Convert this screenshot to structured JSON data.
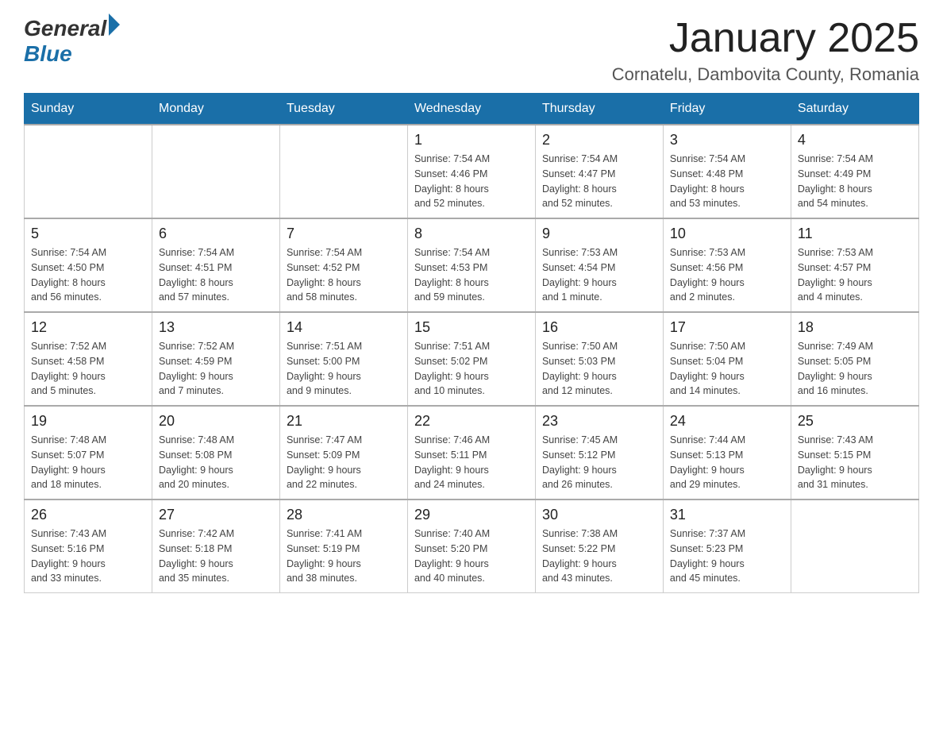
{
  "header": {
    "logo_general": "General",
    "logo_blue": "Blue",
    "month_title": "January 2025",
    "location": "Cornatelu, Dambovita County, Romania"
  },
  "days_of_week": [
    "Sunday",
    "Monday",
    "Tuesday",
    "Wednesday",
    "Thursday",
    "Friday",
    "Saturday"
  ],
  "weeks": [
    [
      {
        "day": "",
        "info": ""
      },
      {
        "day": "",
        "info": ""
      },
      {
        "day": "",
        "info": ""
      },
      {
        "day": "1",
        "info": "Sunrise: 7:54 AM\nSunset: 4:46 PM\nDaylight: 8 hours\nand 52 minutes."
      },
      {
        "day": "2",
        "info": "Sunrise: 7:54 AM\nSunset: 4:47 PM\nDaylight: 8 hours\nand 52 minutes."
      },
      {
        "day": "3",
        "info": "Sunrise: 7:54 AM\nSunset: 4:48 PM\nDaylight: 8 hours\nand 53 minutes."
      },
      {
        "day": "4",
        "info": "Sunrise: 7:54 AM\nSunset: 4:49 PM\nDaylight: 8 hours\nand 54 minutes."
      }
    ],
    [
      {
        "day": "5",
        "info": "Sunrise: 7:54 AM\nSunset: 4:50 PM\nDaylight: 8 hours\nand 56 minutes."
      },
      {
        "day": "6",
        "info": "Sunrise: 7:54 AM\nSunset: 4:51 PM\nDaylight: 8 hours\nand 57 minutes."
      },
      {
        "day": "7",
        "info": "Sunrise: 7:54 AM\nSunset: 4:52 PM\nDaylight: 8 hours\nand 58 minutes."
      },
      {
        "day": "8",
        "info": "Sunrise: 7:54 AM\nSunset: 4:53 PM\nDaylight: 8 hours\nand 59 minutes."
      },
      {
        "day": "9",
        "info": "Sunrise: 7:53 AM\nSunset: 4:54 PM\nDaylight: 9 hours\nand 1 minute."
      },
      {
        "day": "10",
        "info": "Sunrise: 7:53 AM\nSunset: 4:56 PM\nDaylight: 9 hours\nand 2 minutes."
      },
      {
        "day": "11",
        "info": "Sunrise: 7:53 AM\nSunset: 4:57 PM\nDaylight: 9 hours\nand 4 minutes."
      }
    ],
    [
      {
        "day": "12",
        "info": "Sunrise: 7:52 AM\nSunset: 4:58 PM\nDaylight: 9 hours\nand 5 minutes."
      },
      {
        "day": "13",
        "info": "Sunrise: 7:52 AM\nSunset: 4:59 PM\nDaylight: 9 hours\nand 7 minutes."
      },
      {
        "day": "14",
        "info": "Sunrise: 7:51 AM\nSunset: 5:00 PM\nDaylight: 9 hours\nand 9 minutes."
      },
      {
        "day": "15",
        "info": "Sunrise: 7:51 AM\nSunset: 5:02 PM\nDaylight: 9 hours\nand 10 minutes."
      },
      {
        "day": "16",
        "info": "Sunrise: 7:50 AM\nSunset: 5:03 PM\nDaylight: 9 hours\nand 12 minutes."
      },
      {
        "day": "17",
        "info": "Sunrise: 7:50 AM\nSunset: 5:04 PM\nDaylight: 9 hours\nand 14 minutes."
      },
      {
        "day": "18",
        "info": "Sunrise: 7:49 AM\nSunset: 5:05 PM\nDaylight: 9 hours\nand 16 minutes."
      }
    ],
    [
      {
        "day": "19",
        "info": "Sunrise: 7:48 AM\nSunset: 5:07 PM\nDaylight: 9 hours\nand 18 minutes."
      },
      {
        "day": "20",
        "info": "Sunrise: 7:48 AM\nSunset: 5:08 PM\nDaylight: 9 hours\nand 20 minutes."
      },
      {
        "day": "21",
        "info": "Sunrise: 7:47 AM\nSunset: 5:09 PM\nDaylight: 9 hours\nand 22 minutes."
      },
      {
        "day": "22",
        "info": "Sunrise: 7:46 AM\nSunset: 5:11 PM\nDaylight: 9 hours\nand 24 minutes."
      },
      {
        "day": "23",
        "info": "Sunrise: 7:45 AM\nSunset: 5:12 PM\nDaylight: 9 hours\nand 26 minutes."
      },
      {
        "day": "24",
        "info": "Sunrise: 7:44 AM\nSunset: 5:13 PM\nDaylight: 9 hours\nand 29 minutes."
      },
      {
        "day": "25",
        "info": "Sunrise: 7:43 AM\nSunset: 5:15 PM\nDaylight: 9 hours\nand 31 minutes."
      }
    ],
    [
      {
        "day": "26",
        "info": "Sunrise: 7:43 AM\nSunset: 5:16 PM\nDaylight: 9 hours\nand 33 minutes."
      },
      {
        "day": "27",
        "info": "Sunrise: 7:42 AM\nSunset: 5:18 PM\nDaylight: 9 hours\nand 35 minutes."
      },
      {
        "day": "28",
        "info": "Sunrise: 7:41 AM\nSunset: 5:19 PM\nDaylight: 9 hours\nand 38 minutes."
      },
      {
        "day": "29",
        "info": "Sunrise: 7:40 AM\nSunset: 5:20 PM\nDaylight: 9 hours\nand 40 minutes."
      },
      {
        "day": "30",
        "info": "Sunrise: 7:38 AM\nSunset: 5:22 PM\nDaylight: 9 hours\nand 43 minutes."
      },
      {
        "day": "31",
        "info": "Sunrise: 7:37 AM\nSunset: 5:23 PM\nDaylight: 9 hours\nand 45 minutes."
      },
      {
        "day": "",
        "info": ""
      }
    ]
  ]
}
